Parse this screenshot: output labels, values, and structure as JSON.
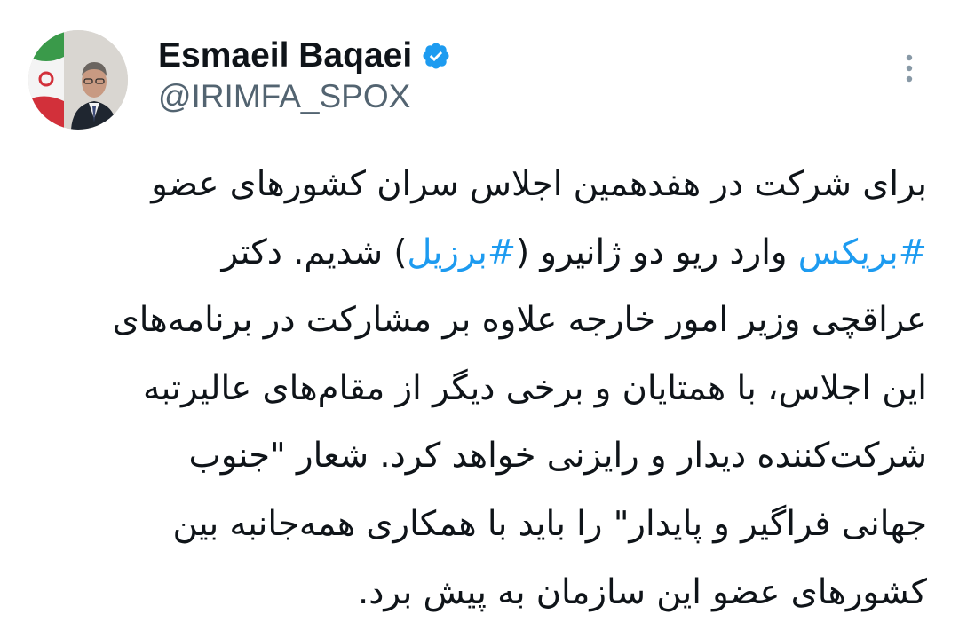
{
  "user": {
    "display_name": "Esmaeil Baqaei",
    "handle": "@IRIMFA_SPOX",
    "verified": true
  },
  "tweet": {
    "lines": [
      [
        {
          "text": "برای شرکت در هفدهمین اجلاس سران کشورهای عضو"
        }
      ],
      [
        {
          "tag": "#بریکس"
        },
        {
          "text": " وارد ریو دو ژانیرو ("
        },
        {
          "tag": "#برزیل"
        },
        {
          "text": ") شدیم. دکتر"
        }
      ],
      [
        {
          "text": "عراقچی وزیر امور خارجه علاوه بر مشارکت در برنامه‌های"
        }
      ],
      [
        {
          "text": "این اجلاس، با همتایان و برخی دیگر از مقام‌های عالیرتبه"
        }
      ],
      [
        {
          "text": "شرکت‌کننده دیدار و رایزنی خواهد کرد. شعار \"جنوب"
        }
      ],
      [
        {
          "text": "جهانی فراگیر و پایدار\" را باید با همکاری همه‌جانبه بین"
        }
      ],
      [
        {
          "text": "کشورهای عضو این سازمان به پیش برد."
        }
      ]
    ]
  },
  "colors": {
    "text": "#0f1419",
    "secondary": "#536471",
    "link": "#1d9bf0",
    "background": "#ffffff"
  },
  "icons": {
    "verified": "verified-badge-icon",
    "more": "more-vertical-icon"
  }
}
